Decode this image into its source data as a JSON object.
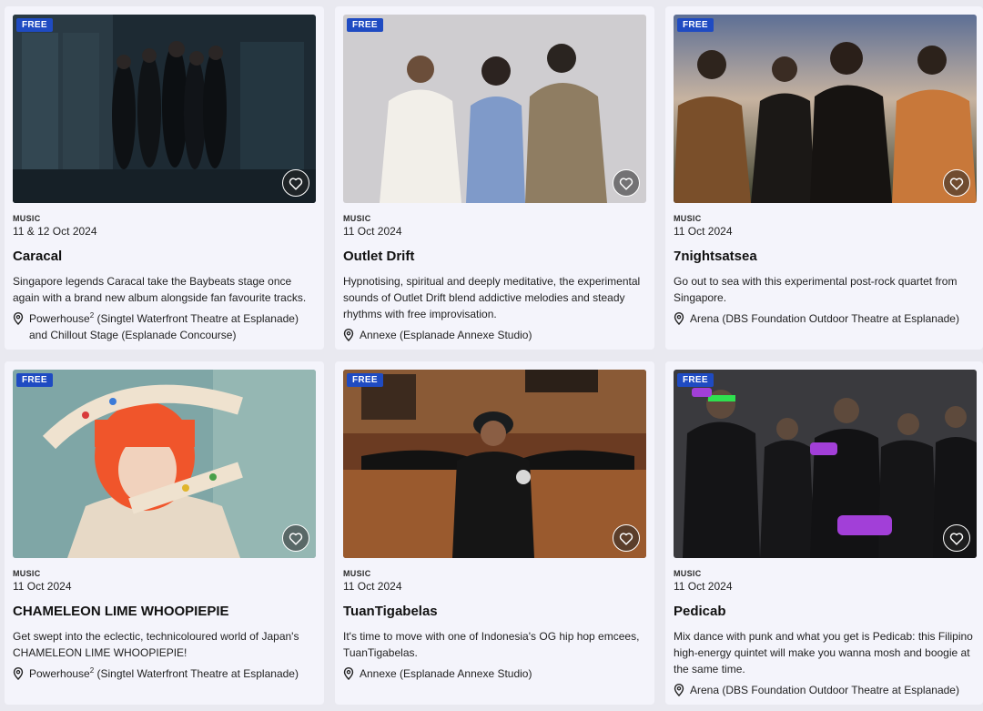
{
  "cards": [
    {
      "badge": "FREE",
      "category": "MUSIC",
      "date": "11 & 12 Oct 2024",
      "title": "Caracal",
      "description": "Singapore legends Caracal take the Baybeats stage once again with a brand new album alongside fan favourite tracks.",
      "venue_prefix": "Powerhouse",
      "venue_sup": "2",
      "venue_rest": " (Singtel Waterfront Theatre at Esplanade) and Chillout Stage (Esplanade Concourse)"
    },
    {
      "badge": "FREE",
      "category": "MUSIC",
      "date": "11 Oct 2024",
      "title": "Outlet Drift",
      "description": "Hypnotising, spiritual and deeply meditative, the experimental sounds of Outlet Drift blend addictive melodies and steady rhythms with free improvisation.",
      "venue_prefix": "Annexe (Esplanade Annexe Studio)",
      "venue_sup": "",
      "venue_rest": ""
    },
    {
      "badge": "FREE",
      "category": "MUSIC",
      "date": "11 Oct 2024",
      "title": "7nightsatsea",
      "description": "Go out to sea with this experimental post-rock quartet from Singapore.",
      "venue_prefix": "Arena (DBS Foundation Outdoor Theatre at Esplanade)",
      "venue_sup": "",
      "venue_rest": ""
    },
    {
      "badge": "FREE",
      "category": "MUSIC",
      "date": "11 Oct 2024",
      "title": "CHAMELEON LIME WHOOPIEPIE",
      "description": "Get swept into the eclectic, technicoloured world of Japan's CHAMELEON LIME WHOOPIEPIE!",
      "venue_prefix": "Powerhouse",
      "venue_sup": "2",
      "venue_rest": " (Singtel Waterfront Theatre at Esplanade)"
    },
    {
      "badge": "FREE",
      "category": "MUSIC",
      "date": "11 Oct 2024",
      "title": "TuanTigabelas",
      "description": "It's time to move with one of Indonesia's OG hip hop emcees, TuanTigabelas.",
      "venue_prefix": "Annexe (Esplanade Annexe Studio)",
      "venue_sup": "",
      "venue_rest": ""
    },
    {
      "badge": "FREE",
      "category": "MUSIC",
      "date": "11 Oct 2024",
      "title": "Pedicab",
      "description": "Mix dance with punk and what you get is Pedicab: this Filipino high-energy quintet will make you wanna mosh and boogie at the same time.",
      "venue_prefix": "Arena (DBS Foundation Outdoor Theatre at Esplanade)",
      "venue_sup": "",
      "venue_rest": ""
    }
  ],
  "icons": {
    "favourite": "heart-icon",
    "venue": "location-pin-icon"
  },
  "colors": {
    "badge_bg": "#1f4bc2",
    "card_bg": "#f4f4fb",
    "page_bg": "#e9e9f0"
  }
}
